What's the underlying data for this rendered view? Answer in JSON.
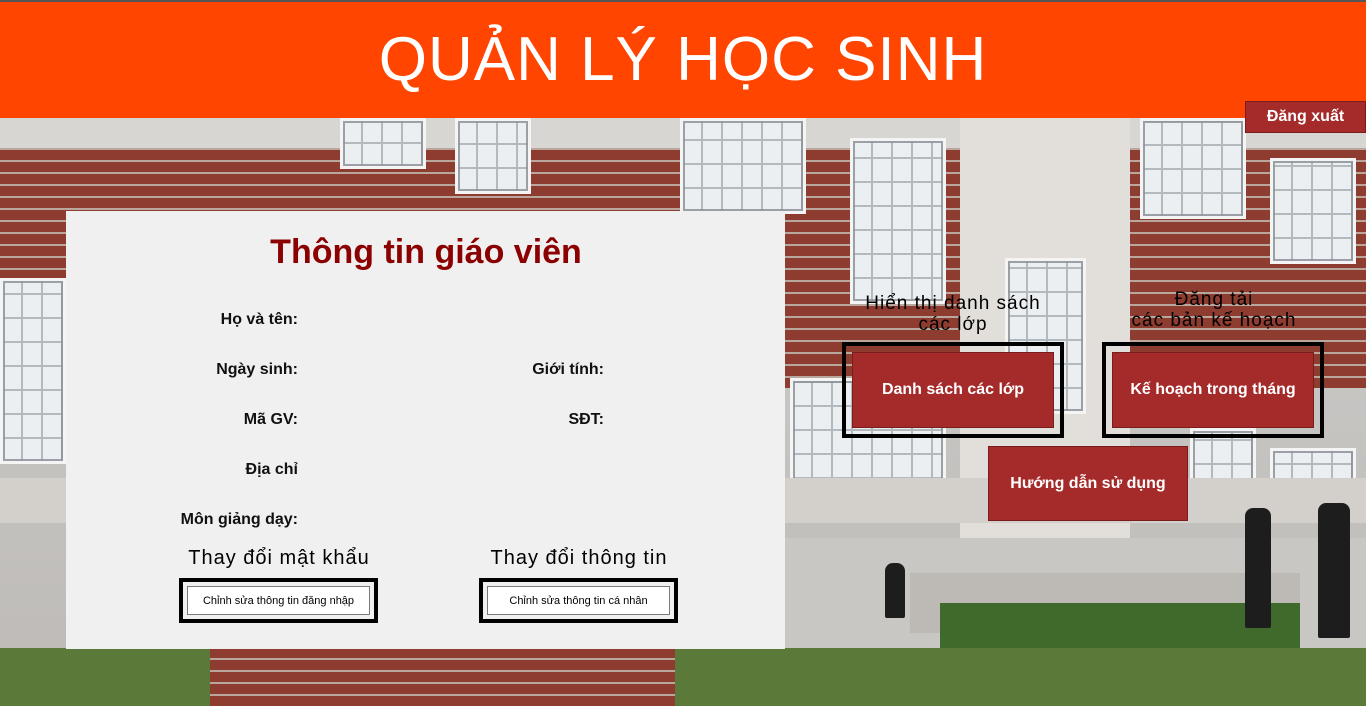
{
  "header": {
    "title": "QUẢN LÝ HỌC SINH",
    "logout_label": "Đăng xuất"
  },
  "teacher_panel": {
    "title": "Thông tin giáo viên",
    "fields": {
      "name_label": "Họ và tên:",
      "dob_label": "Ngày sinh:",
      "gender_label": "Giới tính:",
      "id_label": "Mã GV:",
      "phone_label": "SĐT:",
      "address_label": "Địa chỉ",
      "subject_label": "Môn giảng dạy:"
    },
    "change_password": {
      "caption": "Thay đổi mật khẩu",
      "button_label": "Chỉnh sửa thông tin đăng nhập"
    },
    "change_info": {
      "caption": "Thay đổi thông tin",
      "button_label": "Chỉnh sửa thông tin cá nhân"
    }
  },
  "actions": {
    "class_list": {
      "caption_line1": "Hiển thị danh sách",
      "caption_line2": "các lớp",
      "button_label": "Danh sách các lớp"
    },
    "monthly_plan": {
      "caption_line1": "Đăng tải",
      "caption_line2": "các bản kế hoạch",
      "button_label": "Kế hoạch trong tháng"
    },
    "guide": {
      "button_label": "Hướng dẫn sử dụng"
    }
  },
  "colors": {
    "header": "#ff4500",
    "button": "#a52a2a",
    "title": "#8b0000",
    "panel": "#f0f0f0"
  }
}
